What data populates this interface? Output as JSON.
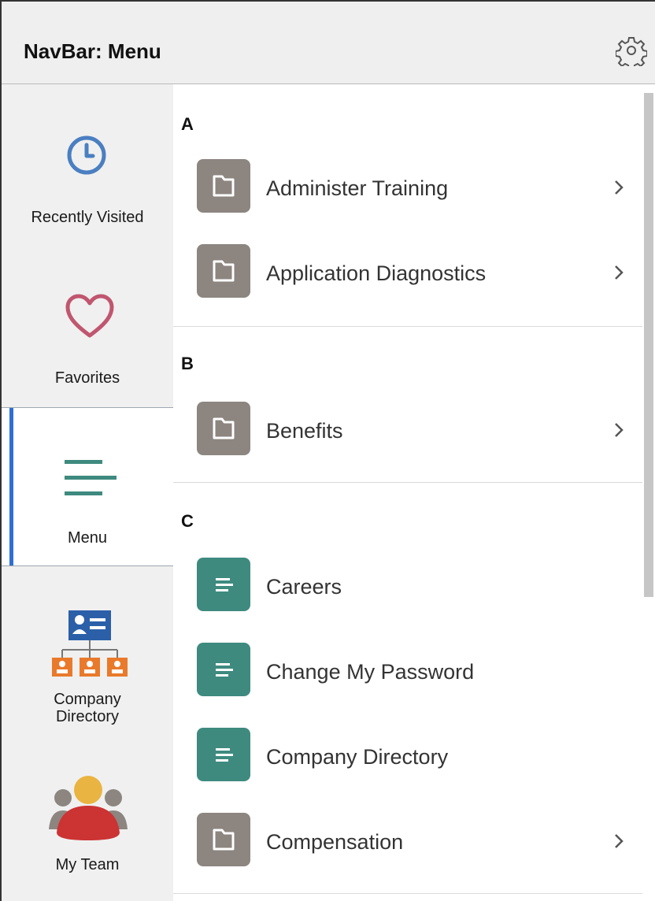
{
  "header": {
    "title": "NavBar: Menu",
    "settings_icon": "gear-icon"
  },
  "sidebar": {
    "items": [
      {
        "label": "Recently Visited",
        "icon": "clock-icon"
      },
      {
        "label": "Favorites",
        "icon": "heart-icon"
      },
      {
        "label": "Menu",
        "icon": "menu-lines-icon",
        "active": true
      },
      {
        "label": "Company\nDirectory",
        "icon": "org-chart-icon"
      },
      {
        "label": "My Team",
        "icon": "team-icon"
      }
    ]
  },
  "menu": {
    "sections": [
      {
        "letter": "A",
        "items": [
          {
            "label": "Administer Training",
            "type": "folder"
          },
          {
            "label": "Application Diagnostics",
            "type": "folder"
          }
        ]
      },
      {
        "letter": "B",
        "items": [
          {
            "label": "Benefits",
            "type": "folder"
          }
        ]
      },
      {
        "letter": "C",
        "items": [
          {
            "label": "Careers",
            "type": "page"
          },
          {
            "label": "Change My Password",
            "type": "page"
          },
          {
            "label": "Company Directory",
            "type": "page"
          },
          {
            "label": "Compensation",
            "type": "folder"
          }
        ]
      }
    ]
  },
  "colors": {
    "active_indicator": "#2f6fd1",
    "folder_tile": "#8c8580",
    "page_tile": "#3e8a7f",
    "clock": "#4a7fc1",
    "heart": "#c0566f",
    "menu_lines": "#3e8a7f"
  }
}
